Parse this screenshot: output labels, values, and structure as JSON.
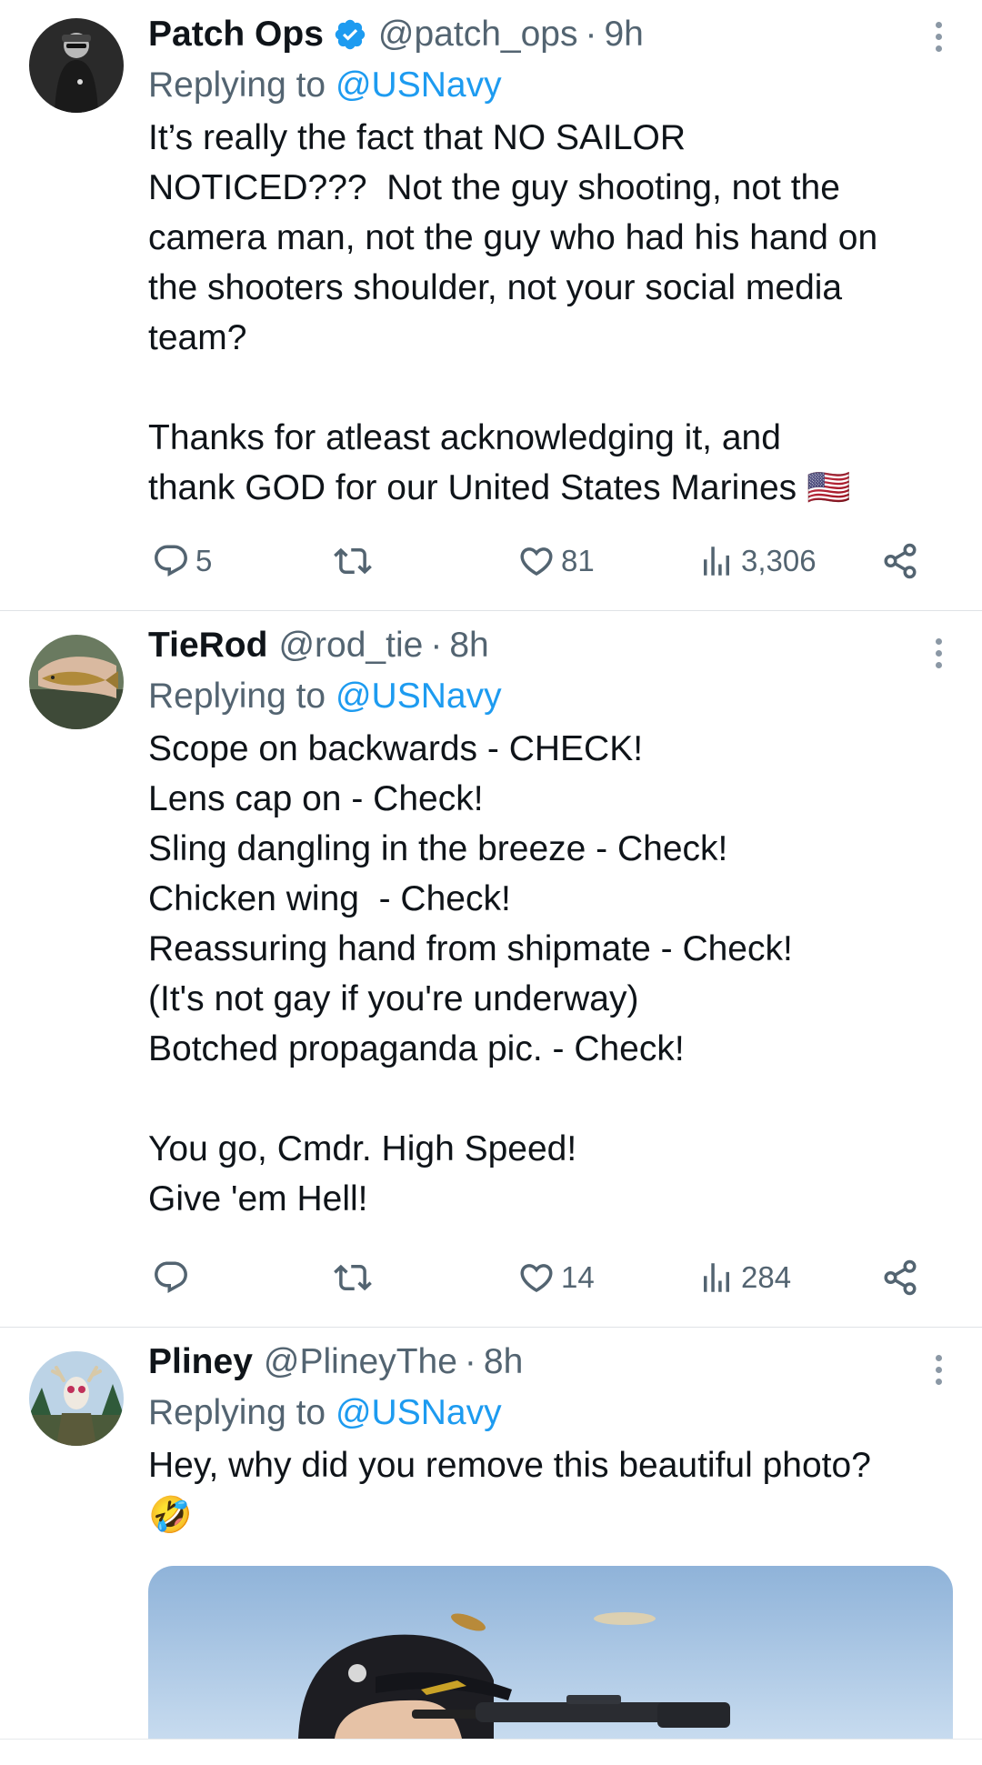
{
  "tweets": [
    {
      "author": {
        "name": "Patch Ops",
        "handle": "@patch_ops",
        "verified": true
      },
      "time": "9h",
      "dot": "·",
      "replying_prefix": "Replying to ",
      "replying_to": "@USNavy",
      "text": "It’s really the fact that NO SAILOR\nNOTICED???  Not the guy shooting, not the\ncamera man, not the guy who had his hand on\nthe shooters shoulder, not your social media\nteam?\n\nThanks for atleast acknowledging it, and\nthank GOD for our United States Marines 🇺🇸",
      "stats": {
        "replies": "5",
        "retweets": "",
        "likes": "81",
        "views": "3,306"
      }
    },
    {
      "author": {
        "name": "TieRod",
        "handle": "@rod_tie",
        "verified": false
      },
      "time": "8h",
      "dot": "·",
      "replying_prefix": "Replying to ",
      "replying_to": "@USNavy",
      "text": "Scope on backwards - CHECK!\nLens cap on - Check!\nSling dangling in the breeze - Check!\nChicken wing  - Check!\nReassuring hand from shipmate - Check!\n(It's not gay if you're underway)\nBotched propaganda pic. - Check!\n\nYou go, Cmdr. High Speed!\nGive 'em Hell!",
      "stats": {
        "replies": "",
        "retweets": "",
        "likes": "14",
        "views": "284"
      }
    },
    {
      "author": {
        "name": "Pliney",
        "handle": "@PlineyThe",
        "verified": false
      },
      "time": "8h",
      "dot": "·",
      "replying_prefix": "Replying to ",
      "replying_to": "@USNavy",
      "text": "Hey, why did you remove this beautiful photo?\n🤣"
    }
  ],
  "icons": {
    "reply": "reply-icon",
    "retweet": "retweet-icon",
    "like": "heart-icon",
    "views": "views-icon",
    "share": "share-icon",
    "verified": "verified-badge-icon",
    "more": "more-options-icon"
  },
  "colors": {
    "text": "#0f1419",
    "secondary": "#536471",
    "mention": "#1d9bf0",
    "verified": "#1d9bf0",
    "divider": "#dfe3e6"
  }
}
